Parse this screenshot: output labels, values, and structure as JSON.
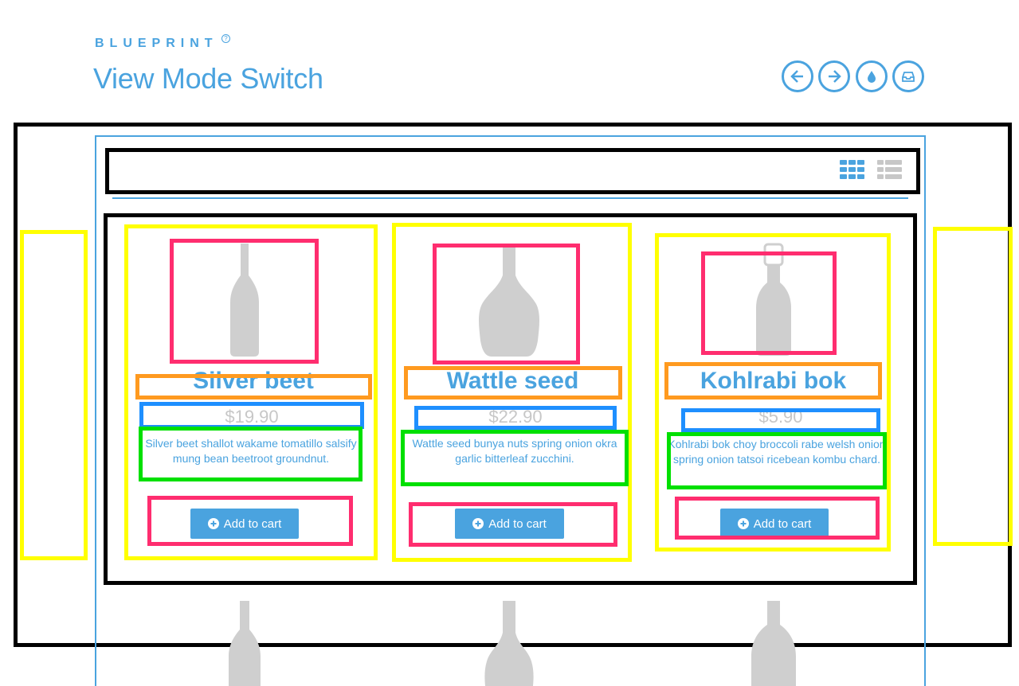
{
  "header": {
    "brand": "BLUEPRINT",
    "help_mark": "?",
    "title": "View Mode Switch"
  },
  "header_buttons": [
    {
      "icon": "arrow-left-icon"
    },
    {
      "icon": "arrow-right-icon"
    },
    {
      "icon": "drop-icon"
    },
    {
      "icon": "inbox-icon"
    }
  ],
  "view_toggle": {
    "active": "grid",
    "options": [
      "grid",
      "list"
    ]
  },
  "products": [
    {
      "name": "Silver beet",
      "price": "$19.90",
      "description": "Silver beet shallot wakame tomatillo salsify mung bean beetroot groundnut.",
      "cart_label": "Add to cart"
    },
    {
      "name": "Wattle seed",
      "price": "$22.90",
      "description": "Wattle seed bunya nuts spring onion okra garlic bitterleaf zucchini.",
      "cart_label": "Add to cart"
    },
    {
      "name": "Kohlrabi bok",
      "price": "$5.90",
      "description": "Kohlrabi bok choy broccoli rabe welsh onion spring onion tatsoi ricebean kombu chard.",
      "cart_label": "Add to cart"
    }
  ],
  "colors": {
    "accent": "#4aa3df",
    "price_grey": "#c7c7c7",
    "annotation_black": "#000000",
    "annotation_yellow": "#ffff00",
    "annotation_pink": "#ff2d6f",
    "annotation_orange": "#ff9a1f",
    "annotation_blue": "#1e8fff",
    "annotation_green": "#00e000"
  }
}
